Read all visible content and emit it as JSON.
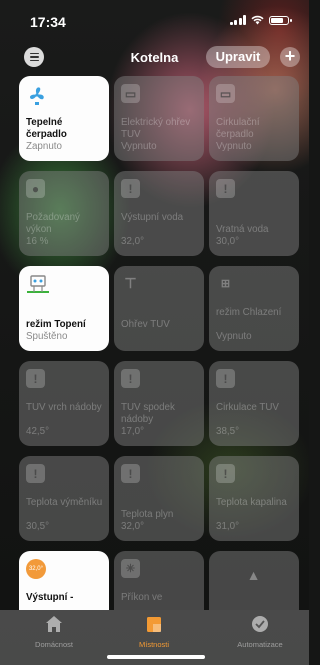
{
  "status_bar": {
    "time": "17:34"
  },
  "header": {
    "title": "Kotelna",
    "edit_label": "Upravit",
    "add_label": "+"
  },
  "tiles": [
    {
      "name": "Tepelné čerpadlo",
      "status": "Zapnuto",
      "icon": "fan-icon",
      "active": true
    },
    {
      "name": "Elektrický ohřev TUV",
      "status": "Vypnuto",
      "icon": "outlet-icon",
      "active": false
    },
    {
      "name": "Cirkulační čerpadlo",
      "status": "Vypnuto",
      "icon": "outlet-icon",
      "active": false
    },
    {
      "name": "Požadovaný výkon",
      "status": "16 %",
      "icon": "humidity-icon",
      "active": false
    },
    {
      "name": "Výstupní voda",
      "status": "32,0°",
      "icon": "alert-icon",
      "active": false
    },
    {
      "name": "Vratná voda",
      "status": "30,0°",
      "icon": "alert-icon",
      "active": false
    },
    {
      "name": "režim Topení",
      "status": "Spuštěno",
      "icon": "sprinkler-icon",
      "active": true
    },
    {
      "name": "Ohřev TUV",
      "status": "",
      "icon": "faucet-icon",
      "active": false
    },
    {
      "name": "režim Chlazení",
      "status": "Vypnuto",
      "icon": "sprinkler-icon",
      "active": false
    },
    {
      "name": "TUV vrch nádoby",
      "status": "42,5°",
      "icon": "alert-icon",
      "active": false
    },
    {
      "name": "TUV spodek nádoby",
      "status": "17,0°",
      "icon": "alert-icon",
      "active": false
    },
    {
      "name": "Cirkulace TUV",
      "status": "38,5°",
      "icon": "alert-icon",
      "active": false
    },
    {
      "name": "Teplota výměníku",
      "status": "30,5°",
      "icon": "alert-icon",
      "active": false
    },
    {
      "name": "Teplota plyn",
      "status": "32,0°",
      "icon": "alert-icon",
      "active": false
    },
    {
      "name": "Teplota kapalina",
      "status": "31,0°",
      "icon": "alert-icon",
      "active": false
    },
    {
      "name": "Výstupní -",
      "status": "",
      "badge": "32,0°",
      "icon": "temperature-badge",
      "active": true
    },
    {
      "name": "Příkon ve",
      "status": "",
      "icon": "light-sensor-icon",
      "active": false
    },
    {
      "name": "",
      "status": "",
      "icon": "bell-icon",
      "active": false
    }
  ],
  "tabbar": {
    "items": [
      {
        "label": "Domácnost",
        "icon": "house-icon",
        "active": false
      },
      {
        "label": "Místnosti",
        "icon": "rooms-icon",
        "active": true
      },
      {
        "label": "Automatizace",
        "icon": "automation-icon",
        "active": false
      }
    ]
  },
  "colors": {
    "accent": "#f39a34",
    "tile_on": "#fdfdfd",
    "badge": "#f29a3a"
  }
}
